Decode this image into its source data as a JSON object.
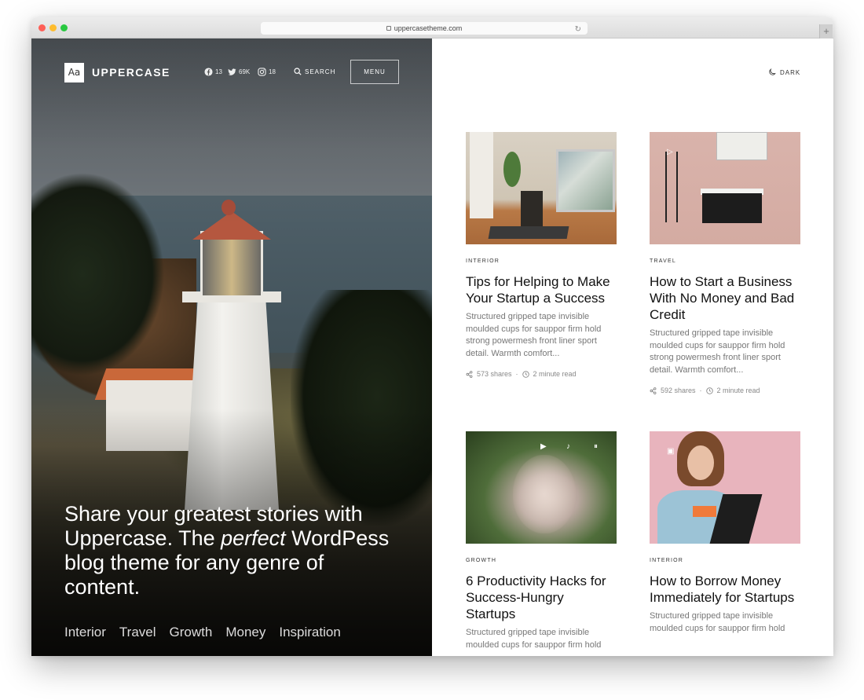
{
  "browser": {
    "url": "uppercasetheme.com"
  },
  "header": {
    "logo_mark": "Aa",
    "logo_text": "UPPERCASE",
    "social": [
      {
        "icon": "facebook-icon",
        "count": "13"
      },
      {
        "icon": "twitter-icon",
        "count": "69K"
      },
      {
        "icon": "instagram-icon",
        "count": "18"
      }
    ],
    "search_label": "SEARCH",
    "menu_label": "MENU",
    "dark_label": "DARK"
  },
  "hero": {
    "tagline_before": "Share your greatest stories with Uppercase. The ",
    "tagline_em": "perfect",
    "tagline_after": " WordPess blog theme for any genre of content.",
    "categories": [
      "Interior",
      "Travel",
      "Growth",
      "Money",
      "Inspiration"
    ]
  },
  "posts": [
    {
      "category": "INTERIOR",
      "title": "Tips for Helping to Make Your Startup a Success",
      "excerpt": "Structured gripped tape invisible moulded cups for sauppor firm hold strong powermesh front liner sport detail. Warmth comfort...",
      "shares": "573 shares",
      "read": "2 minute read"
    },
    {
      "category": "TRAVEL",
      "title": "How to Start a Business With No Money and Bad Credit",
      "excerpt": "Structured gripped tape invisible moulded cups for sauppor firm hold strong powermesh front liner sport detail. Warmth comfort...",
      "shares": "592 shares",
      "read": "2 minute read"
    },
    {
      "category": "GROWTH",
      "title": "6 Productivity Hacks for Success-Hungry Startups",
      "excerpt": "Structured gripped tape invisible moulded cups for sauppor firm hold",
      "shares": "",
      "read": ""
    },
    {
      "category": "INTERIOR",
      "title": "How to Borrow Money Immediately for Startups",
      "excerpt": "Structured gripped tape invisible moulded cups for sauppor firm hold",
      "shares": "",
      "read": ""
    }
  ]
}
